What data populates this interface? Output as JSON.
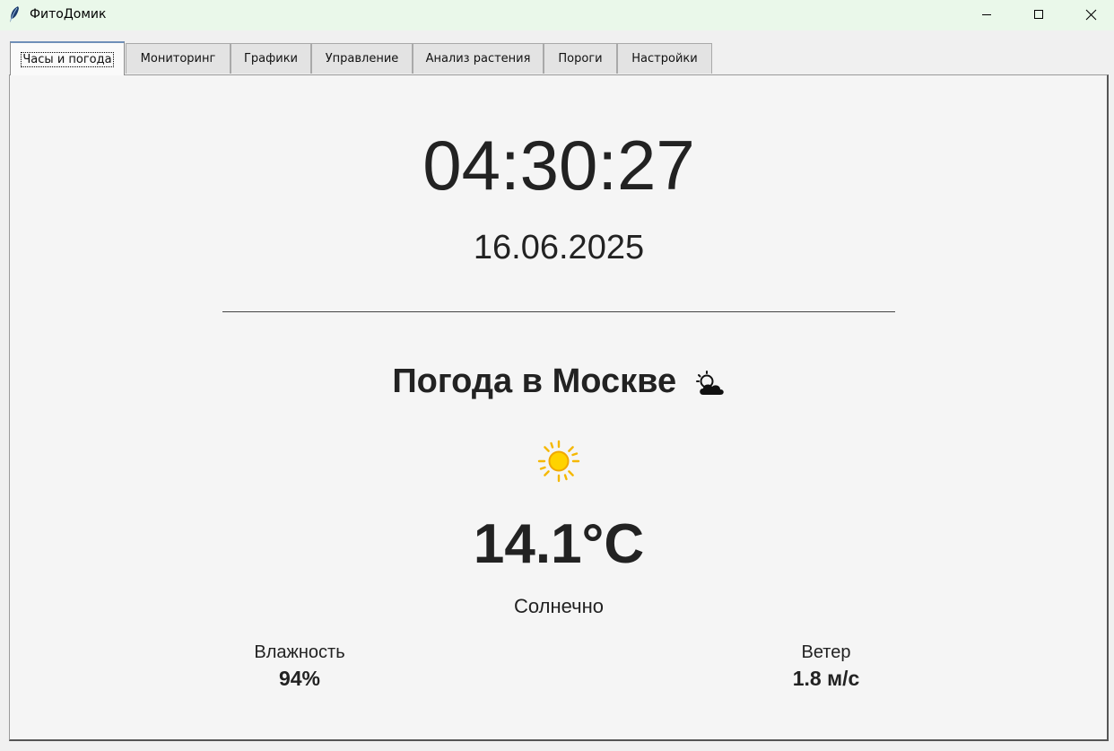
{
  "window": {
    "title": "ФитоДомик",
    "icon": "feather-icon",
    "controls": [
      "minimize-icon",
      "maximize-icon",
      "close-icon"
    ]
  },
  "tabs": [
    {
      "label": "Часы и погода",
      "active": true
    },
    {
      "label": "Мониторинг",
      "active": false
    },
    {
      "label": "Графики",
      "active": false
    },
    {
      "label": "Управление",
      "active": false
    },
    {
      "label": "Анализ растения",
      "active": false
    },
    {
      "label": "Пороги",
      "active": false
    },
    {
      "label": "Настройки",
      "active": false
    }
  ],
  "clock": {
    "time": "04:30:27",
    "date": "16.06.2025"
  },
  "weather": {
    "title": "Погода в Москве",
    "title_icon": "sun-behind-cloud-icon",
    "condition_icon": "sun-icon",
    "temperature": "14.1°C",
    "condition": "Солнечно",
    "humidity_label": "Влажность",
    "humidity_value": "94%",
    "wind_label": "Ветер",
    "wind_value": "1.8 м/с"
  },
  "colors": {
    "titlebar_bg": "#eaf8ea",
    "panel_bg": "#f5f5f5",
    "text": "#222222",
    "sun": "#f5b800"
  }
}
